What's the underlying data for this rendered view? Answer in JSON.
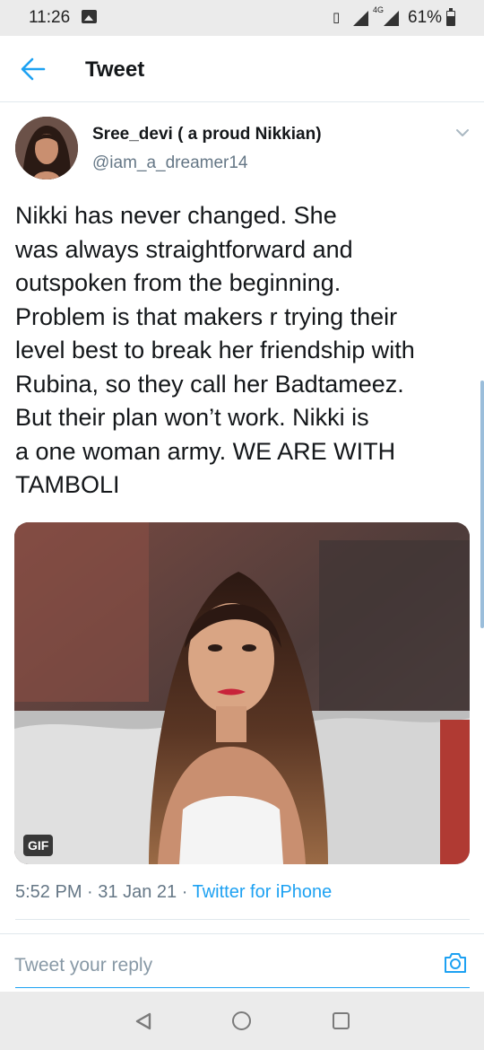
{
  "status_bar": {
    "time": "11:26",
    "network": "4G",
    "battery": "61%"
  },
  "header": {
    "title": "Tweet"
  },
  "tweet": {
    "author_name": "Sree_devi ( a proud Nikkian)",
    "author_handle": "@iam_a_dreamer14",
    "text": "Nikki has never changed. She\nwas always straightforward and\noutspoken from the beginning.\nProblem is that makers r trying their\nlevel best to break her friendship with\nRubina, so they call her Badtameez.\nBut their plan won’t work. Nikki is\na one woman army. WE ARE WITH\nTAMBOLI",
    "media_badge": "GIF",
    "time": "5:52 PM",
    "date": "31 Jan 21",
    "separator": "·",
    "source": "Twitter for iPhone"
  },
  "reply": {
    "placeholder": "Tweet your reply"
  },
  "colors": {
    "accent": "#1da1f2",
    "secondary_text": "#657786",
    "primary_text": "#14171a"
  },
  "icons": {
    "back": "arrow-left-icon",
    "more": "chevron-down-icon",
    "camera": "camera-icon",
    "nav_back": "triangle-back-icon",
    "nav_home": "circle-home-icon",
    "nav_recent": "square-recents-icon"
  }
}
